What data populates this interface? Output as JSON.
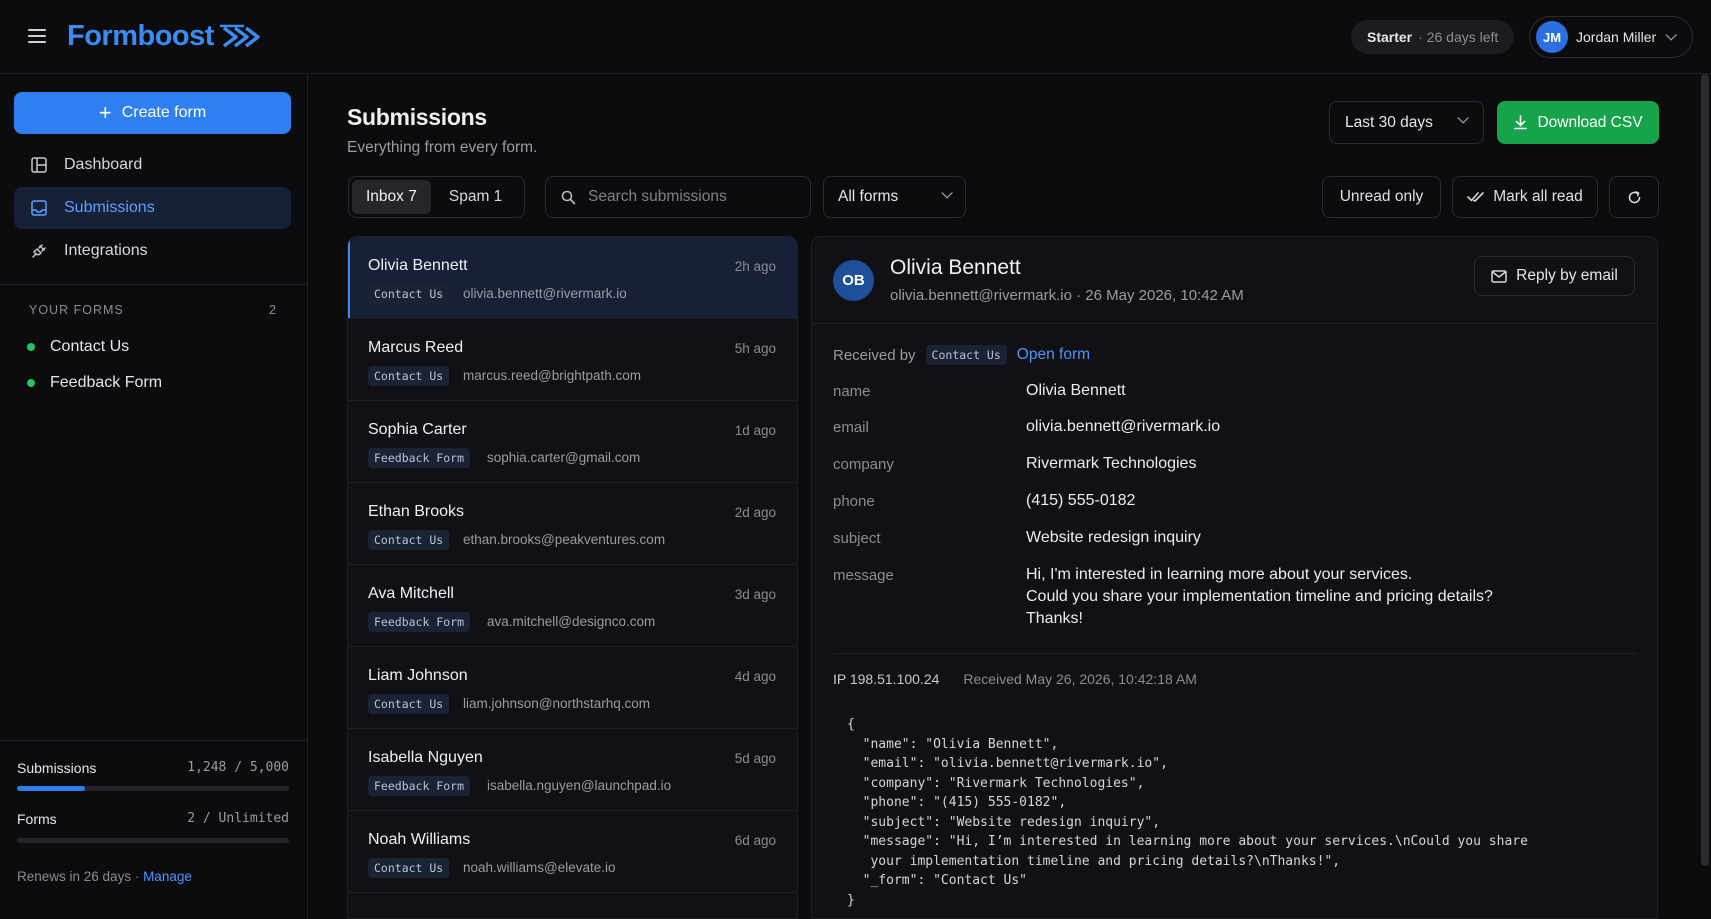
{
  "app": {
    "name": "Formboost"
  },
  "plan": {
    "name": "Starter",
    "days_left": "· 26 days left"
  },
  "user": {
    "initials": "JM",
    "name": "Jordan Miller"
  },
  "sidebar": {
    "create_label": "Create form",
    "nav": [
      {
        "label": "Dashboard",
        "icon": "dashboard-icon"
      },
      {
        "label": "Submissions",
        "icon": "inbox-icon",
        "active": true
      },
      {
        "label": "Integrations",
        "icon": "plug-icon"
      }
    ],
    "forms_heading": "YOUR FORMS",
    "forms_count": "2",
    "forms": [
      "Contact Us",
      "Feedback Form"
    ],
    "usage": {
      "submissions_label": "Submissions",
      "submissions_value": "1,248 / 5,000",
      "submissions_fraction": 0.25,
      "forms_label": "Forms",
      "forms_value": "2 / Unlimited",
      "forms_fraction": 0
    },
    "renews_text": "Renews in 26 days · ",
    "manage_label": "Manage"
  },
  "main": {
    "title": "Submissions",
    "subtitle": "Everything from every form.",
    "range_label": "Last 30 days",
    "download_label": "Download CSV",
    "tabs": [
      {
        "label": "Inbox 7",
        "active": true
      },
      {
        "label": "Spam 1"
      }
    ],
    "search_placeholder": "Search submissions",
    "forms_filter": "All forms",
    "unread_label": "Unread only",
    "mark_read_label": "Mark all read"
  },
  "submissions": [
    {
      "name": "Olivia Bennett",
      "time": "2h ago",
      "form": "Contact Us",
      "email": "olivia.bennett@rivermark.io",
      "active": true
    },
    {
      "name": "Marcus Reed",
      "time": "5h ago",
      "form": "Contact Us",
      "email": "marcus.reed@brightpath.com"
    },
    {
      "name": "Sophia Carter",
      "time": "1d ago",
      "form": "Feedback Form",
      "email": "sophia.carter@gmail.com"
    },
    {
      "name": "Ethan Brooks",
      "time": "2d ago",
      "form": "Contact Us",
      "email": "ethan.brooks@peakventures.com"
    },
    {
      "name": "Ava Mitchell",
      "time": "3d ago",
      "form": "Feedback Form",
      "email": "ava.mitchell@designco.com"
    },
    {
      "name": "Liam Johnson",
      "time": "4d ago",
      "form": "Contact Us",
      "email": "liam.johnson@northstarhq.com"
    },
    {
      "name": "Isabella Nguyen",
      "time": "5d ago",
      "form": "Feedback Form",
      "email": "isabella.nguyen@launchpad.io"
    },
    {
      "name": "Noah Williams",
      "time": "6d ago",
      "form": "Contact Us",
      "email": "noah.williams@elevate.io"
    }
  ],
  "detail": {
    "initials": "OB",
    "name": "Olivia Bennett",
    "meta": "olivia.bennett@rivermark.io · 26 May 2026, 10:42 AM",
    "reply_label": "Reply by email",
    "received_by_label": "Received by",
    "form_tag": "Contact Us",
    "open_form_label": "Open form",
    "fields": [
      {
        "label": "name",
        "value": "Olivia Bennett"
      },
      {
        "label": "email",
        "value": "olivia.bennett@rivermark.io"
      },
      {
        "label": "company",
        "value": "Rivermark Technologies"
      },
      {
        "label": "phone",
        "value": "(415) 555-0182"
      },
      {
        "label": "subject",
        "value": "Website redesign inquiry"
      },
      {
        "label": "message",
        "value": "Hi, I'm interested in learning more about your services.\nCould you share your implementation timeline and pricing details?\nThanks!"
      }
    ],
    "ip": "IP 198.51.100.24",
    "received": "Received May 26, 2026, 10:42:18 AM",
    "raw_json": "{\n  \"name\": \"Olivia Bennett\",\n  \"email\": \"olivia.bennett@rivermark.io\",\n  \"company\": \"Rivermark Technologies\",\n  \"phone\": \"(415) 555-0182\",\n  \"subject\": \"Website redesign inquiry\",\n  \"message\": \"Hi, I’m interested in learning more about your services.\\nCould you share\n   your implementation timeline and pricing details?\\nThanks!\",\n  \"_form\": \"Contact Us\"\n}"
  },
  "colors": {
    "accent": "#2f7ff0",
    "success": "#16a34a",
    "active_row": "#172036"
  }
}
